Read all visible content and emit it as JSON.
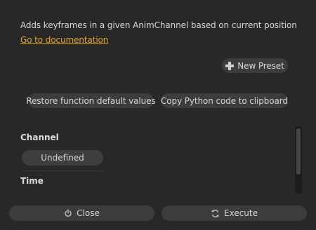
{
  "description": "Adds keyframes in a given AnimChannel based on current position",
  "doc_link": "Go to documentation",
  "buttons": {
    "new_preset": "New Preset",
    "restore_defaults": "Restore function default values",
    "copy_python": "Copy Python code to clipboard"
  },
  "params": {
    "channel_label": "Channel",
    "channel_value": "Undefined",
    "time_label": "Time"
  },
  "footer": {
    "close": "Close",
    "execute": "Execute"
  },
  "icons": {
    "new_preset": "plus-icon",
    "close": "power-icon",
    "execute": "refresh-icon"
  },
  "colors": {
    "background": "#282828",
    "button": "#3c3c3c",
    "link": "#e0a526",
    "text": "#d6d6d6"
  }
}
